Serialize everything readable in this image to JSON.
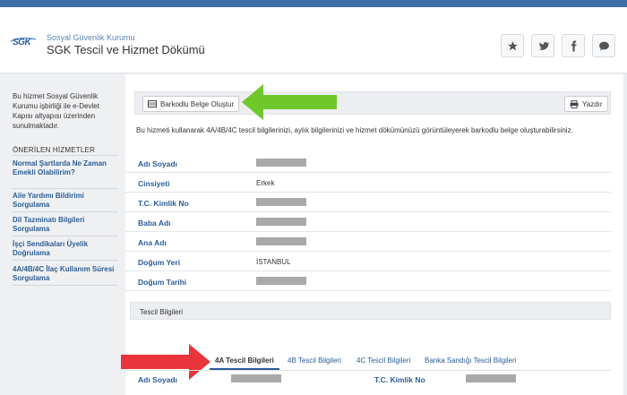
{
  "header": {
    "logo": "SGK",
    "institution": "Sosyal Güvenlik Kurumu",
    "title": "SGK Tescil ve Hizmet Dökümü",
    "social_icons": [
      "star-icon",
      "twitter-icon",
      "facebook-icon",
      "comment-icon"
    ]
  },
  "sidebar": {
    "intro": "Bu hizmet Sosyal Güvenlik Kurumu işbirliği ile e-Devlet Kapısı altyapısı üzerinden sunulmaktadır.",
    "heading": "ÖNERİLEN HİZMETLER",
    "items": [
      {
        "label": "Normal Şartlarda Ne Zaman Emekli Olabilirim?"
      },
      {
        "label": "Aile Yardımı Bildirimi Sorgulama"
      },
      {
        "label": "Dil Tazminatı Bilgileri Sorgulama"
      },
      {
        "label": "İşçi Sendikaları Üyelik Doğrulama"
      },
      {
        "label": "4A/4B/4C İlaç Kullanım Süresi Sorgulama"
      }
    ]
  },
  "toolbar": {
    "barcode_button": "Barkodlu Belge Oluştur",
    "print_button": "Yazdır"
  },
  "description": "Bu hizmeti kullanarak 4A/4B/4C tescil bilgilerinizi, aylık bilgilerinizi ve hizmet dökümünüzü görüntüleyerek barkodlu belge oluşturabilirsiniz.",
  "info_rows": [
    {
      "label": "Adı Soyadı",
      "value": ""
    },
    {
      "label": "Cinsiyeti",
      "value": "Erkek"
    },
    {
      "label": "T.C. Kimlik No",
      "value": ""
    },
    {
      "label": "Baba Adı",
      "value": ""
    },
    {
      "label": "Ana Adı",
      "value": ""
    },
    {
      "label": "Doğum Yeri",
      "value": "İSTANBUL"
    },
    {
      "label": "Doğum Tarihi",
      "value": ""
    }
  ],
  "section_title": "Tescil Bilgileri",
  "tabs": [
    {
      "label": "4A Tescil Bilgileri"
    },
    {
      "label": "4B Tescil Bilgileri"
    },
    {
      "label": "4C Tescil Bilgileri"
    },
    {
      "label": "Banka Sandığı Tescil Bilgileri"
    }
  ],
  "bottom_labels": {
    "name": "Adı Soyadı",
    "tc": "T.C. Kimlik No"
  },
  "colors": {
    "accent": "#2a5d96",
    "topbar": "#3b6ea5",
    "green_arrow": "#6fc829",
    "red_arrow": "#e8343a"
  }
}
